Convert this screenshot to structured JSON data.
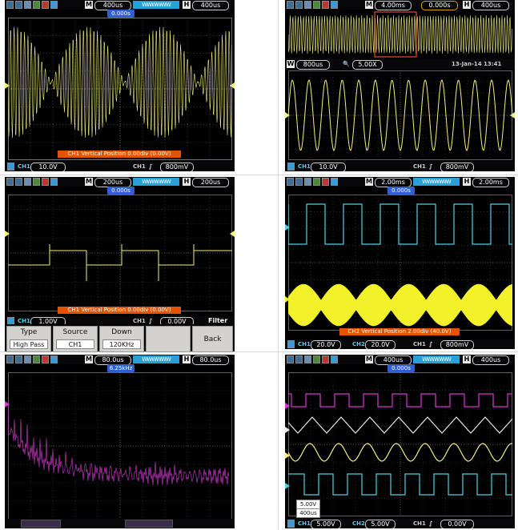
{
  "panels": [
    {
      "id": "p1",
      "top": {
        "mode": "M",
        "timebase": "400us",
        "delay": "400us"
      },
      "trigger_pos": "0.000s",
      "bottom": {
        "ch1": "10.0V",
        "trig_ch": "CH1",
        "trig_level": "800mV"
      },
      "notice": "CH1 Vertical Position 0.00div (0.00V)",
      "colors": {
        "ch1": "#f2f080"
      }
    },
    {
      "id": "p2",
      "top": {
        "mode": "M",
        "timebase": "4.00ms",
        "delay": "0.000s",
        "delay2": "400us"
      },
      "zoom": {
        "window": "800us",
        "factor": "5.00X",
        "date": "13-Jan-14 13:41"
      },
      "bottom": {
        "ch1": "10.0V",
        "trig_ch": "CH1",
        "trig_level": "800mV"
      },
      "colors": {
        "ch1": "#f2f080",
        "window": "#e05030"
      }
    },
    {
      "id": "p3",
      "top": {
        "mode": "M",
        "timebase": "200us",
        "delay": "200us"
      },
      "trigger_pos": "0.000s",
      "bottom": {
        "ch1": "1.00V",
        "trig_ch": "CH1",
        "trig_level": "0.00V"
      },
      "notice": "CH1 Vertical Position 0.00div (0.00V)",
      "menu": {
        "title": "Filter",
        "items": [
          {
            "label": "Type",
            "value": "High Pass"
          },
          {
            "label": "Source",
            "value": "CH1"
          },
          {
            "label": "Down",
            "value": "120KHz"
          }
        ],
        "back": "Back"
      },
      "colors": {
        "ch1": "#f2f080"
      }
    },
    {
      "id": "p4",
      "top": {
        "mode": "M",
        "timebase": "2.00ms",
        "delay": "2.00ms"
      },
      "trigger_pos": "0.000s",
      "bottom": {
        "ch1": "20.0V",
        "ch2": "20.0V",
        "trig_ch": "CH1",
        "trig_level": "800mV"
      },
      "notice": "CH2 Vertical Position 2.00div (40.0V)",
      "colors": {
        "ch1": "#f3f22a",
        "ch2": "#4fd0e0"
      }
    },
    {
      "id": "p5",
      "top": {
        "mode": "M",
        "timebase": "80.0us",
        "delay": "80.0us"
      },
      "trigger_pos": "6.25kHz",
      "colors": {
        "math": "#d23ad0"
      }
    },
    {
      "id": "p6",
      "top": {
        "mode": "M",
        "timebase": "400us",
        "delay": "400us"
      },
      "trigger_pos": "0.000s",
      "bottom": {
        "ch1": "5.00V",
        "ch2": "5.00V",
        "trig_ch": "CH1",
        "trig_level": "0.00V"
      },
      "readout": {
        "volts": "5.00V",
        "time": "400us"
      },
      "colors": {
        "ch1": "#f2f080",
        "ch2": "#4fd0e0",
        "ch3": "#d23ad0",
        "ch4": "#e6e6e6"
      }
    }
  ]
}
